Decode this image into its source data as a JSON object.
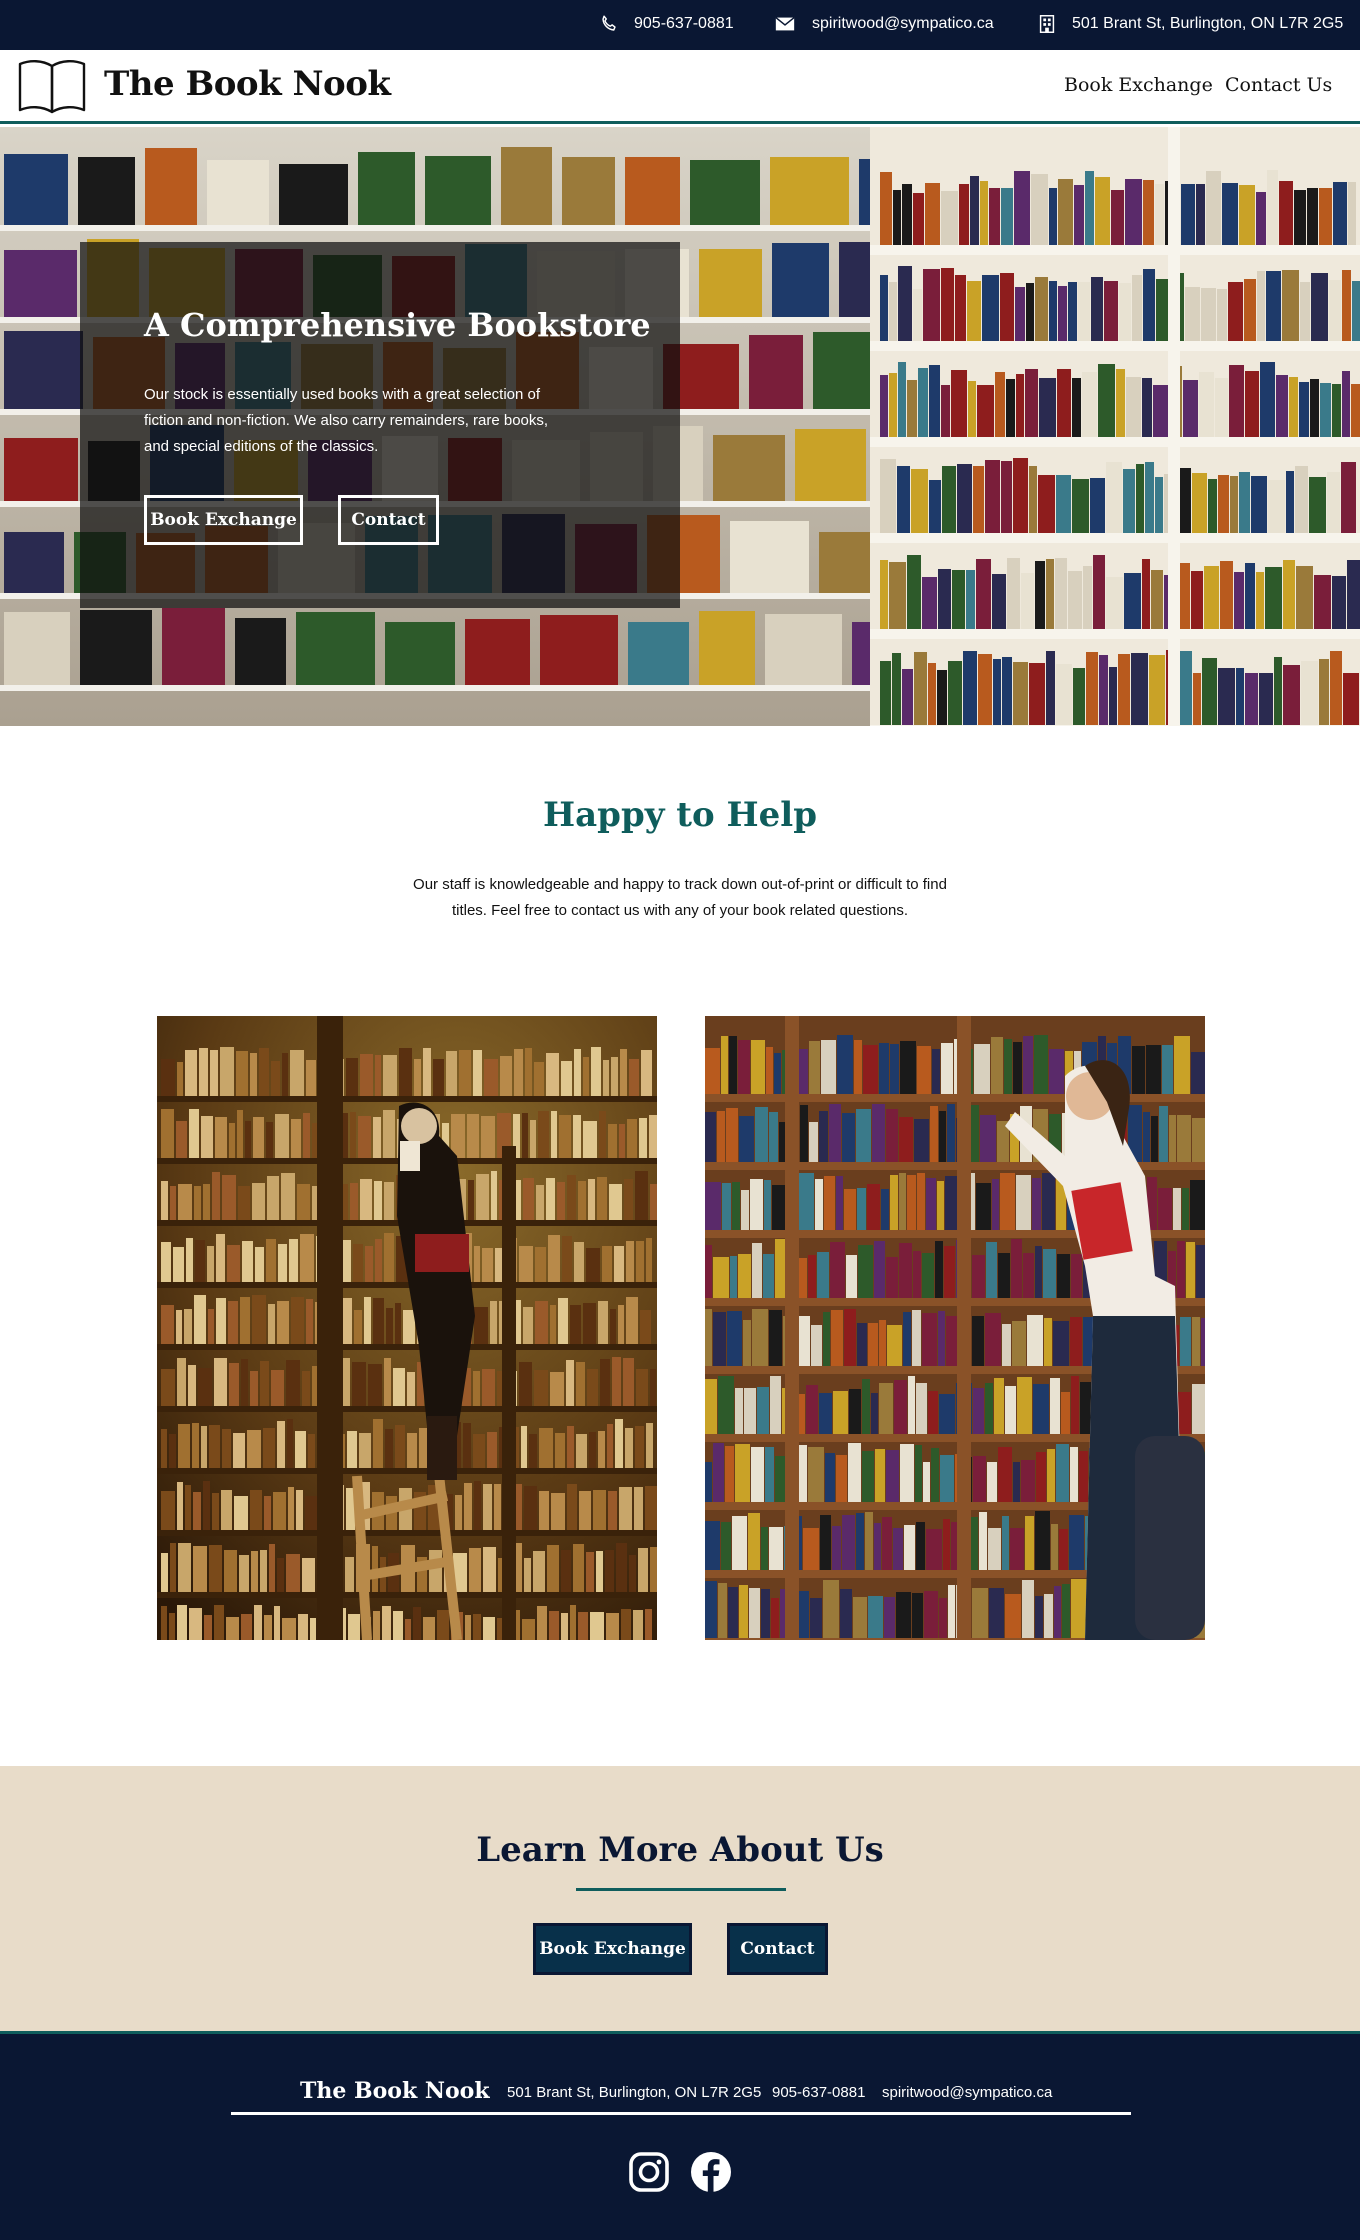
{
  "topbar": {
    "phone": "905-637-0881",
    "email": "spiritwood@sympatico.ca",
    "address": "501 Brant St, Burlington, ON L7R 2G5",
    "icons": [
      "phone-icon",
      "mail-icon",
      "building-icon"
    ]
  },
  "header": {
    "site_title": "The Book Nook",
    "nav": [
      "Book Exchange",
      "Contact Us"
    ]
  },
  "hero": {
    "title": "A Comprehensive Bookstore",
    "text": "Our stock is essentially used books with a great selection of fiction and non-fiction. We also carry remainders, rare books, and special editions of the classics.",
    "button_exchange": "Book Exchange",
    "button_contact": "Contact"
  },
  "help": {
    "title": "Happy to Help",
    "text": "Our staff is knowledgeable and happy to track down out-of-print or difficult to find titles. Feel free to contact us with any of your book related questions."
  },
  "learn": {
    "title": "Learn More About Us",
    "button_exchange": "Book Exchange",
    "button_contact": "Contact"
  },
  "footer": {
    "brand": "The Book Nook",
    "address": "501 Brant St, Burlington, ON L7R 2G5",
    "phone": "905-637-0881",
    "email": "spiritwood@sympatico.ca",
    "social": [
      "instagram-icon",
      "facebook-icon"
    ]
  },
  "colors": {
    "navy": "#0a1733",
    "teal": "#0f5d5c",
    "beige": "#e8dcc9",
    "button_blue": "#08304a"
  }
}
